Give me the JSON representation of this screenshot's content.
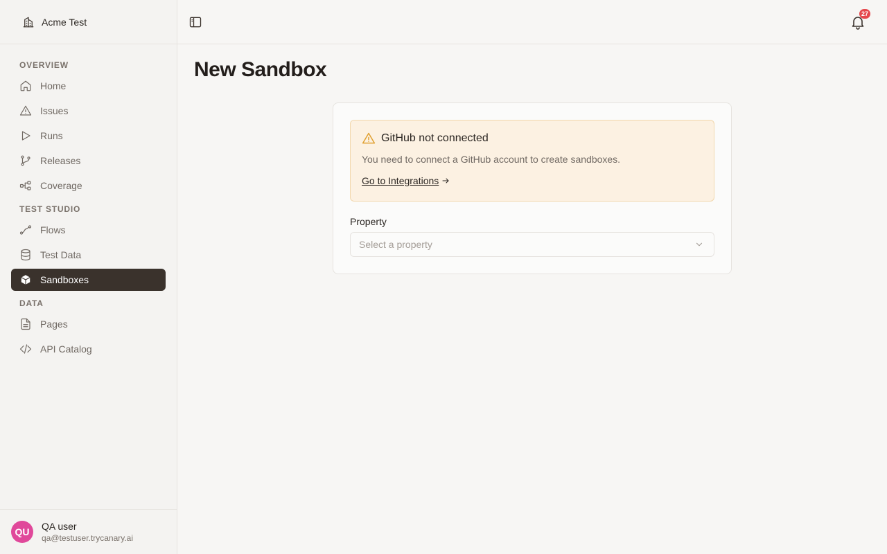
{
  "org": {
    "name": "Acme Test",
    "icon": "building-icon"
  },
  "sidebar": {
    "sections": [
      {
        "label": "OVERVIEW",
        "items": [
          {
            "label": "Home",
            "icon": "home-icon"
          },
          {
            "label": "Issues",
            "icon": "alert-triangle-icon"
          },
          {
            "label": "Runs",
            "icon": "play-icon"
          },
          {
            "label": "Releases",
            "icon": "git-branch-icon"
          },
          {
            "label": "Coverage",
            "icon": "network-icon"
          }
        ]
      },
      {
        "label": "TEST STUDIO",
        "items": [
          {
            "label": "Flows",
            "icon": "flow-icon"
          },
          {
            "label": "Test Data",
            "icon": "database-icon"
          },
          {
            "label": "Sandboxes",
            "icon": "box-icon",
            "active": true
          }
        ]
      },
      {
        "label": "DATA",
        "items": [
          {
            "label": "Pages",
            "icon": "file-text-icon"
          },
          {
            "label": "API Catalog",
            "icon": "code-icon"
          }
        ]
      }
    ]
  },
  "user": {
    "initials": "QU",
    "name": "QA user",
    "email": "qa@testuser.trycanary.ai",
    "avatar_color": "#e0489a"
  },
  "topbar": {
    "notification_count": "27"
  },
  "main": {
    "title": "New Sandbox",
    "alert": {
      "title": "GitHub not connected",
      "description": "You need to connect a GitHub account to create sandboxes.",
      "link_label": "Go to Integrations",
      "accent": "#e0a030"
    },
    "property": {
      "label": "Property",
      "placeholder": "Select a property"
    }
  }
}
